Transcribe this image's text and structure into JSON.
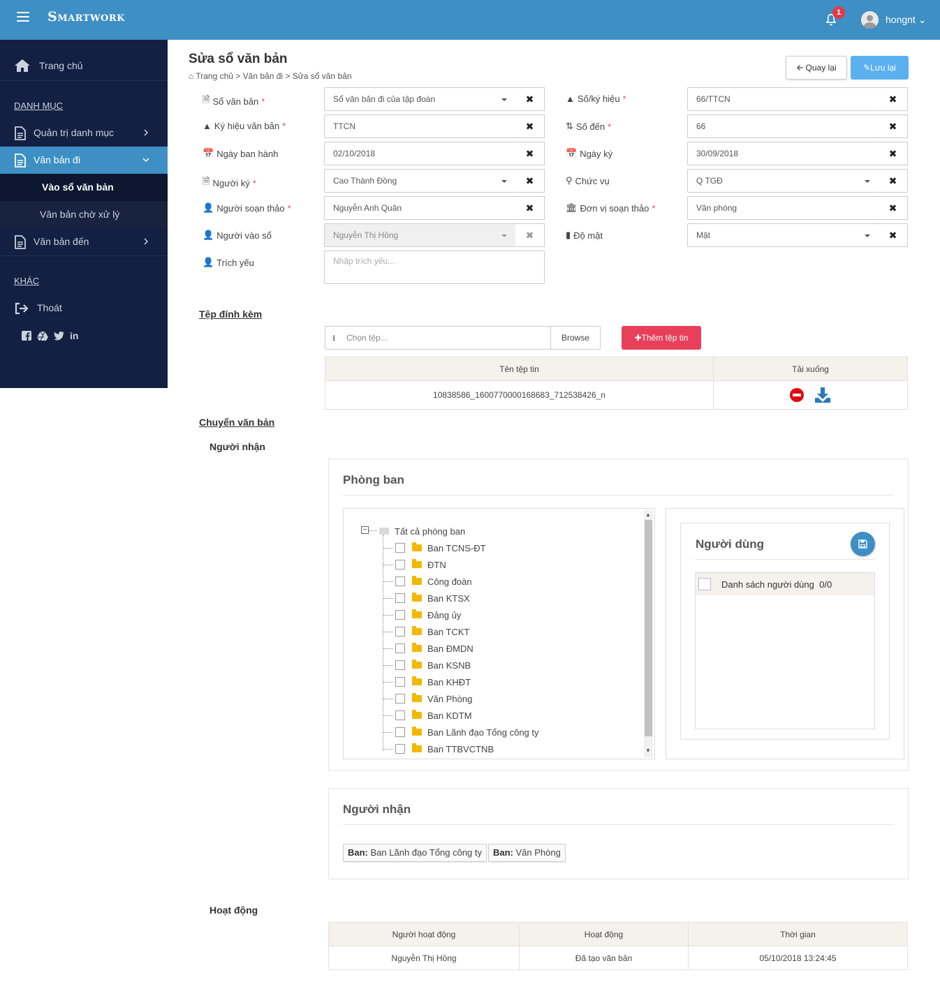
{
  "app": {
    "brand": "Smartwork",
    "notifications": "1",
    "user": "hongnt"
  },
  "sidebar": {
    "home": "Trang chủ",
    "section1": "DANH MỤC",
    "admin": "Quản trị danh mục",
    "outgoing": "Văn bản đi",
    "sub_register": "Vào sổ văn bản",
    "sub_pending": "Văn bản chờ xử lý",
    "incoming": "Văn bản đến",
    "section2": "KHÁC",
    "logout": "Thoát"
  },
  "page": {
    "title": "Sửa sổ văn bản",
    "breadcrumb": [
      "Trang chủ",
      "Văn bản đi",
      "Sửa sổ văn bản"
    ],
    "back_label": "Quay lại",
    "save_label": "Lưu lại"
  },
  "form": {
    "so_van_ban": {
      "label": "Sổ văn bản",
      "value": "Sổ văn bản đi của tập đoàn"
    },
    "so_ky_hieu": {
      "label": "Số/ký hiệu",
      "value": "66/TTCN"
    },
    "ky_hieu": {
      "label": "Ký hiệu văn bản",
      "value": "TTCN"
    },
    "so_den": {
      "label": "Số đến",
      "value": "66"
    },
    "ngay_ban_hanh": {
      "label": "Ngày ban hành",
      "value": "02/10/2018"
    },
    "ngay_ky": {
      "label": "Ngày ký",
      "value": "30/09/2018"
    },
    "nguoi_ky": {
      "label": "Người ký",
      "value": "Cao Thành Đồng"
    },
    "chuc_vu": {
      "label": "Chức vụ",
      "value": "Q TGĐ"
    },
    "nguoi_soan": {
      "label": "Người soạn thảo",
      "value": "Nguyễn Anh Quân"
    },
    "don_vi": {
      "label": "Đơn vị soạn thảo",
      "value": "Văn phòng"
    },
    "nguoi_vao_so": {
      "label": "Người vào sổ",
      "value": "Nguyễn Thị Hồng"
    },
    "do_mat": {
      "label": "Độ mật",
      "value": "Mật"
    },
    "trich_yeu": {
      "label": "Trích yếu",
      "placeholder": "Nhập trích yếu..."
    }
  },
  "attachments": {
    "title": "Tệp đính kèm",
    "file_placeholder": "Chọn tệp...",
    "browse": "Browse",
    "add_button": "Thêm tệp tin",
    "col_name": "Tên tệp tin",
    "col_download": "Tải xuống",
    "files": [
      "10838586_1600770000168683_712538426_n"
    ]
  },
  "transfer": {
    "title": "Chuyển văn bản",
    "recipients_heading": "Người nhận",
    "dept_panel_title": "Phòng ban",
    "tree_root": "Tất cả phòng ban",
    "departments": [
      "Ban TCNS-ĐT",
      "ĐTN",
      "Công đoàn",
      "Ban KTSX",
      "Đảng ủy",
      "Ban TCKT",
      "Ban ĐMDN",
      "Ban KSNB",
      "Ban KHĐT",
      "Văn Phòng",
      "Ban KDTM",
      "Ban Lãnh đạo Tổng công ty",
      "Ban TTBVCTNB"
    ],
    "users_title": "Người dùng",
    "users_list": "Danh sách người dùng",
    "users_count": "0/0",
    "recipients_panel_title": "Người nhận",
    "tags": [
      {
        "prefix": "Ban:",
        "name": "Ban Lãnh đạo Tổng công ty"
      },
      {
        "prefix": "Ban:",
        "name": "Văn Phòng"
      }
    ]
  },
  "activity": {
    "title": "Hoạt động",
    "cols": [
      "Người hoạt động",
      "Hoạt động",
      "Thời gian"
    ],
    "rows": [
      [
        "Nguyễn Thị Hồng",
        "Đã tạo văn bản",
        "05/10/2018 13:24:45"
      ]
    ]
  },
  "colors": {
    "topbar": "#3d8fc4",
    "sidebar": "#142042",
    "active": "#3d8fc4",
    "danger": "#e8405a",
    "primary": "#5bb0ee"
  }
}
